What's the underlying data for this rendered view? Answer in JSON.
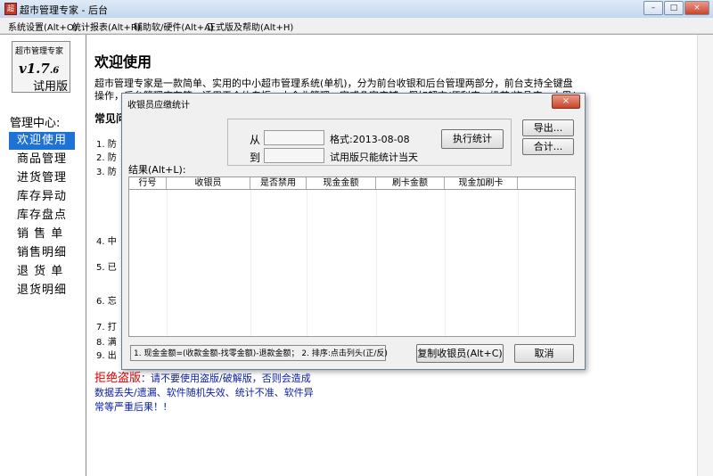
{
  "window": {
    "title": "超市管理专家 - 后台",
    "app_icon_glyph": "超"
  },
  "window_buttons": [
    "–",
    "□",
    "×"
  ],
  "menu": [
    "系统设置(Alt+O)",
    "统计报表(Alt+R)",
    "辅助软/硬件(Alt+A)",
    "正式版及帮助(Alt+H)"
  ],
  "logo": {
    "name": "超市管理专家",
    "version_main": "v1.7",
    "version_sub": ".6",
    "trial": "试用版"
  },
  "sidebar": {
    "heading": "管理中心:",
    "items": [
      {
        "label": "欢迎使用",
        "active": true
      },
      {
        "label": "商品管理"
      },
      {
        "label": "进货管理"
      },
      {
        "label": "库存异动"
      },
      {
        "label": "库存盘点"
      },
      {
        "label": "销 售 单"
      },
      {
        "label": "销售明细"
      },
      {
        "label": "退 货 单"
      },
      {
        "label": "退货明细"
      }
    ]
  },
  "welcome": {
    "title": "欢迎使用",
    "intro": "超市管理专家是一款简单、实用的中小超市管理系统(单机)，分为前台收银和后台管理两部分，前台支持全键盘操作，后台管理库存等，适用于个体专柜、小企业管理一家或几家店铺，假如超市/便利店，奶茶/饰品店，水果/茶叶店等。",
    "faq_title": "常见问",
    "faq_items": [
      "1. 防",
      "2. 防",
      "3. 防",
      "4. 中",
      "5. 已",
      "6. 忘",
      "7. 打",
      "8. 满",
      "9. 出"
    ],
    "warning_title": "拒绝盗版",
    "warning_body": "：请不要使用盗版/破解版，否则会造成数据丢失/遗漏、软件随机失效、统计不准、软件异常等严重后果！!"
  },
  "dialog": {
    "title": "收银员应缴统计",
    "close_label": "×",
    "from_label": "从",
    "to_label": "到",
    "from_value": "",
    "to_value": "",
    "format_hint": "格式:2013-08-08",
    "trial_hint": "试用版只能统计当天",
    "run_button": "执行统计",
    "export_button": "导出...",
    "total_button": "合计...",
    "result_label": "结果(Alt+L):",
    "columns": [
      "行号",
      "收银员",
      "是否禁用",
      "现金金额",
      "刷卡金额",
      "现金加刷卡"
    ],
    "note": "1. 现金金额=(收款金额-找零金额)-退款金额； 2. 排序:点击列头(正/反)",
    "copy_button": "复制收银员(Alt+C)",
    "cancel_button": "取消"
  }
}
